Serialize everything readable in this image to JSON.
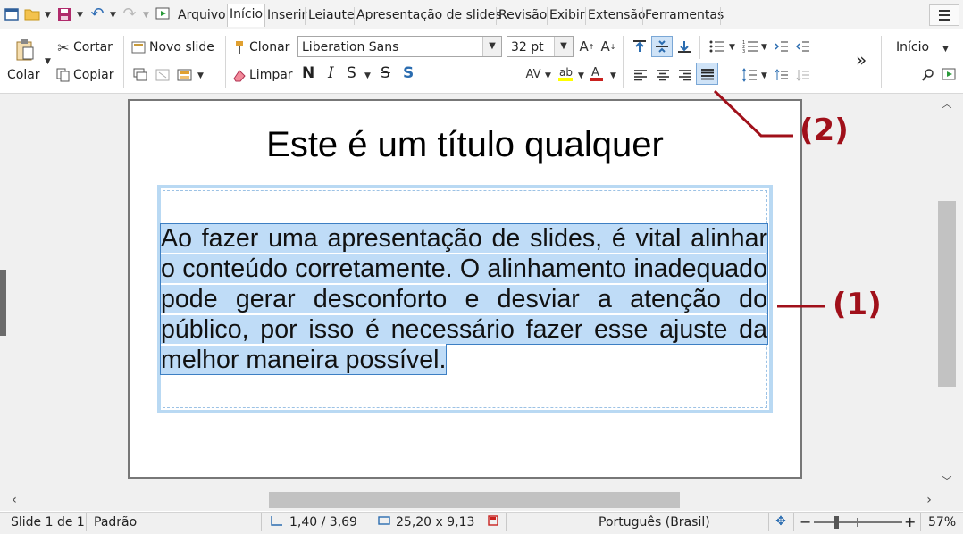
{
  "toolbar_quick": {
    "icons": [
      "new-slide-icon",
      "open-folder-icon",
      "save-icon",
      "undo-icon",
      "redo-icon",
      "start-presentation-icon"
    ]
  },
  "tabs": [
    "Arquivo",
    "Início",
    "Inserir",
    "Leiaute",
    "Apresentação de slides",
    "Revisão",
    "Exibir",
    "Extensão",
    "Ferramentas"
  ],
  "active_tab": "Início",
  "ribbon": {
    "paste": "Colar",
    "cut": "Cortar",
    "copy": "Copiar",
    "new_slide": "Novo slide",
    "clone": "Clonar",
    "clear": "Limpar",
    "font_name": "Liberation Sans",
    "font_size": "32 pt",
    "bold": "N",
    "italic": "I",
    "underline": "S",
    "strike": "S",
    "shadow": "S",
    "more": "»",
    "styles_dropdown": "Início",
    "active_alignment": "justify",
    "accent_active": "#cfe3f7"
  },
  "slide": {
    "title": "Este é um título qualquer",
    "body": "Ao fazer uma apresentação de slides, é vital alinhar o conteúdo corretamente. O alinhamento inadequado pode gerar desconforto e desviar a atenção do público, por isso é necessário fazer esse ajuste da melhor maneira possível."
  },
  "annotations": {
    "one": "(1)",
    "two": "(2)",
    "color": "#a0101a"
  },
  "status": {
    "slide": "Slide 1 de 1",
    "layout": "Padrão",
    "position": "1,40 / 3,69",
    "size": "25,20 x 9,13",
    "language": "Português (Brasil)",
    "zoom": "57%"
  }
}
